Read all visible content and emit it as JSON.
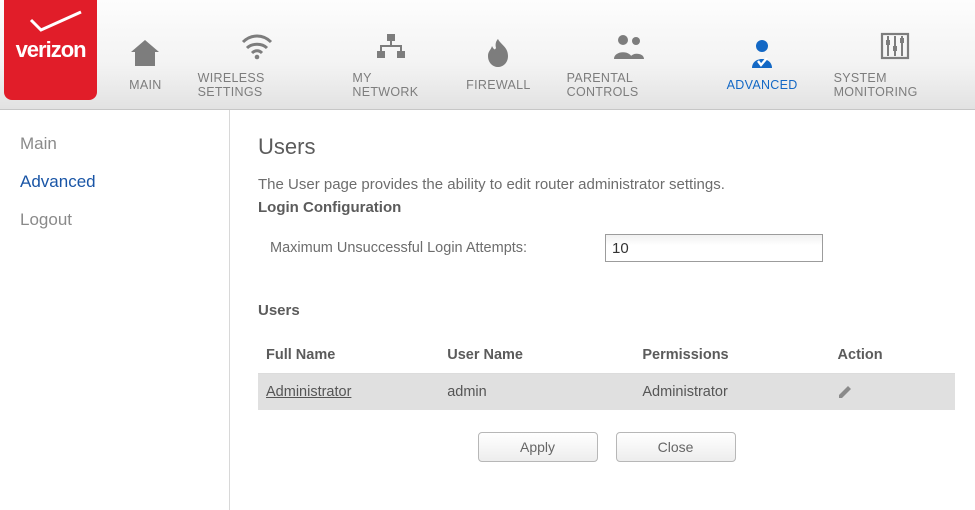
{
  "brand": "verizon",
  "nav": [
    {
      "label": "MAIN"
    },
    {
      "label": "WIRELESS SETTINGS"
    },
    {
      "label": "MY NETWORK"
    },
    {
      "label": "FIREWALL"
    },
    {
      "label": "PARENTAL CONTROLS"
    },
    {
      "label": "ADVANCED"
    },
    {
      "label": "SYSTEM MONITORING"
    }
  ],
  "sidebar": {
    "items": [
      {
        "label": "Main"
      },
      {
        "label": "Advanced"
      },
      {
        "label": "Logout"
      }
    ]
  },
  "page": {
    "title": "Users",
    "description": "The User page provides the ability to edit router administrator settings.",
    "login_config_label": "Login Configuration",
    "max_attempts_label": "Maximum Unsuccessful Login Attempts:",
    "max_attempts_value": "10",
    "users_label": "Users",
    "columns": {
      "fullname": "Full Name",
      "username": "User Name",
      "permissions": "Permissions",
      "action": "Action"
    },
    "rows": [
      {
        "fullname": "Administrator",
        "username": "admin",
        "permissions": "Administrator"
      }
    ],
    "buttons": {
      "apply": "Apply",
      "close": "Close"
    }
  }
}
